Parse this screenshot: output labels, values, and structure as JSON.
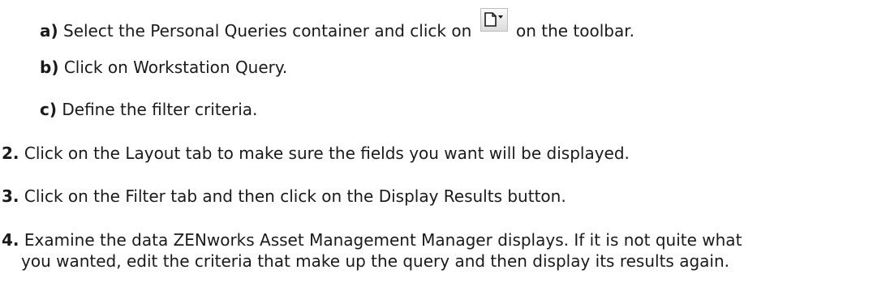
{
  "steps": {
    "a": {
      "marker": "a)",
      "text_before": " Select the Personal Queries container and click on ",
      "icon": "new-query-dropdown-icon",
      "text_after": " on the toolbar."
    },
    "b": {
      "marker": "b)",
      "text": " Click on Workstation Query."
    },
    "c": {
      "marker": "c)",
      "text": " Define the filter criteria."
    },
    "s2": {
      "marker": "2.",
      "text": " Click on the Layout tab to make sure the fields you want will be displayed."
    },
    "s3": {
      "marker": "3.",
      "text": " Click on the Filter tab and then click on the Display Results button."
    },
    "s4": {
      "marker": "4.",
      "text": " Examine the data ZENworks Asset Management Manager displays. If it is not quite what",
      "continuation": "you wanted, edit the criteria that make up the query and then display its results again."
    }
  }
}
